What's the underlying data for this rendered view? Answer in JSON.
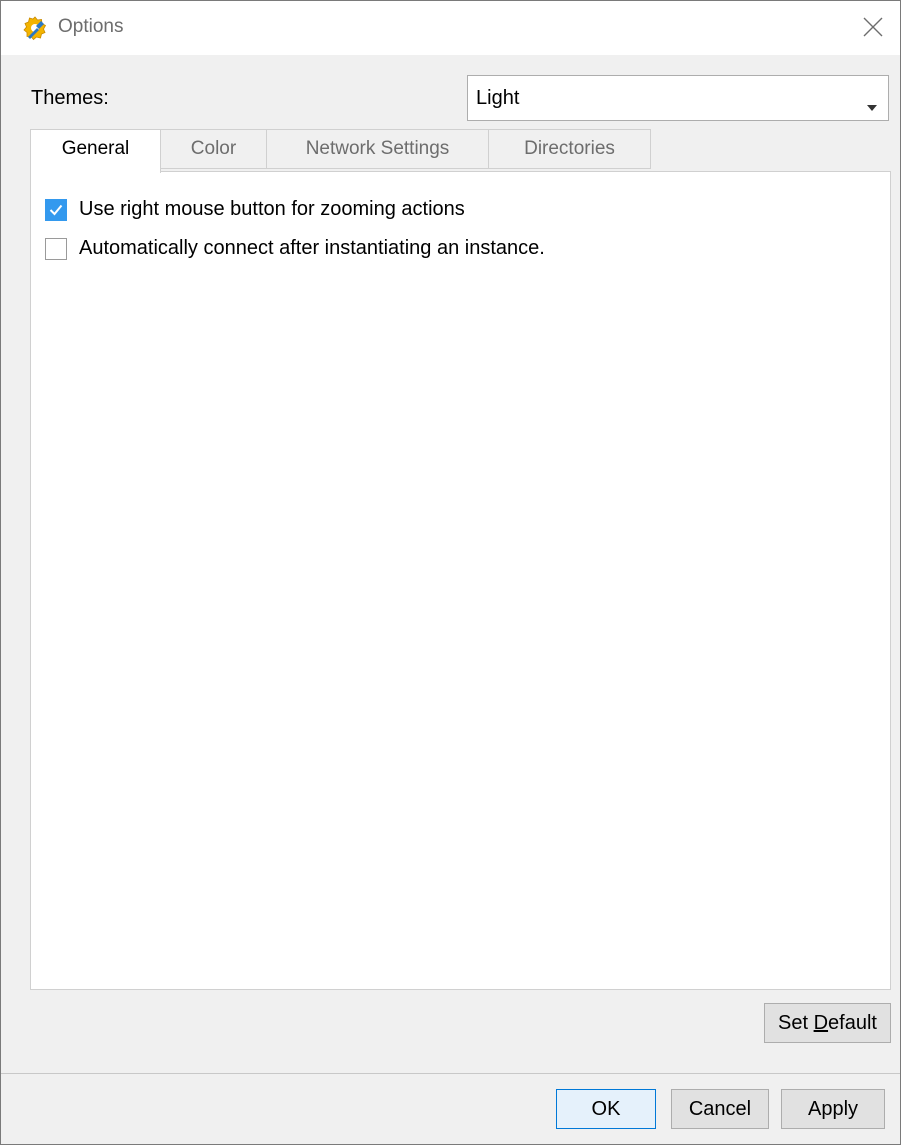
{
  "window": {
    "title": "Options",
    "app_icon": "gear-wrench-icon",
    "close_icon": "close-icon"
  },
  "themes": {
    "label": "Themes:",
    "selected": "Light"
  },
  "tabs": [
    {
      "label": "General",
      "active": true
    },
    {
      "label": "Color",
      "active": false
    },
    {
      "label": "Network Settings",
      "active": false
    },
    {
      "label": "Directories",
      "active": false
    }
  ],
  "general": {
    "options": [
      {
        "label": "Use right mouse button for zooming actions",
        "checked": true
      },
      {
        "label": "Automatically connect after instantiating an instance.",
        "checked": false
      }
    ]
  },
  "buttons": {
    "set_default_prefix": "Set ",
    "set_default_mnemonic": "D",
    "set_default_suffix": "efault",
    "ok": "OK",
    "cancel": "Cancel",
    "apply": "Apply"
  },
  "colors": {
    "accent": "#3399ee",
    "default_button_border": "#0078d7",
    "window_bg": "#f0f0f0"
  }
}
